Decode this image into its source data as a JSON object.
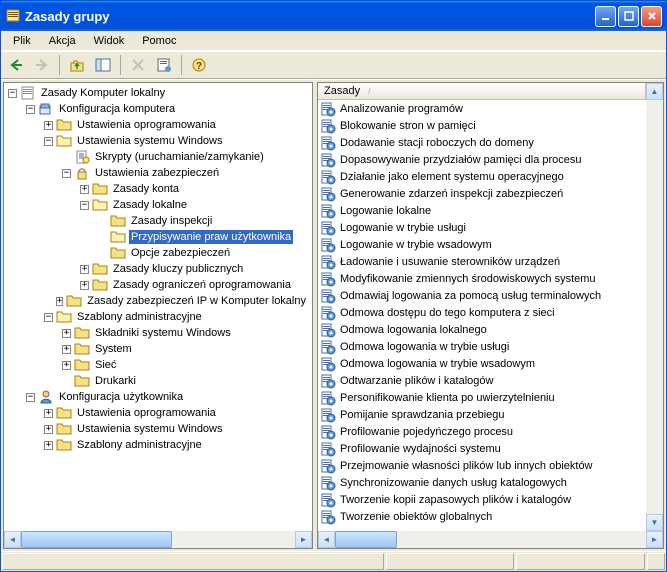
{
  "window": {
    "title": "Zasady grupy"
  },
  "menu": {
    "file": "Plik",
    "action": "Akcja",
    "view": "Widok",
    "help": "Pomoc"
  },
  "tree": {
    "root": "Zasady Komputer lokalny",
    "computer_config": "Konfiguracja komputera",
    "software_settings": "Ustawienia oprogramowania",
    "windows_settings": "Ustawienia systemu Windows",
    "scripts": "Skrypty (uruchamianie/zamykanie)",
    "security_settings": "Ustawienia zabezpieczeń",
    "account_policies": "Zasady konta",
    "local_policies": "Zasady lokalne",
    "audit_policy": "Zasady inspekcji",
    "user_rights": "Przypisywanie praw użytkownika",
    "security_options": "Opcje zabezpieczeń",
    "public_key": "Zasady kluczy publicznych",
    "software_restrict": "Zasady ograniczeń oprogramowania",
    "ipsec": "Zasady zabezpieczeń IP w Komputer lokalny",
    "admin_templates": "Szablony administracyjne",
    "windows_components": "Składniki systemu Windows",
    "system": "System",
    "network": "Sieć",
    "printers": "Drukarki",
    "user_config": "Konfiguracja użytkownika",
    "u_software_settings": "Ustawienia oprogramowania",
    "u_windows_settings": "Ustawienia systemu Windows",
    "u_admin_templates": "Szablony administracyjne"
  },
  "list": {
    "header": "Zasady",
    "items": [
      "Analizowanie programów",
      "Blokowanie stron w pamięci",
      "Dodawanie stacji roboczych do domeny",
      "Dopasowywanie przydziałów pamięci dla procesu",
      "Działanie jako element systemu operacyjnego",
      "Generowanie zdarzeń inspekcji zabezpieczeń",
      "Logowanie lokalne",
      "Logowanie w trybie usługi",
      "Logowanie w trybie wsadowym",
      "Ładowanie i usuwanie sterowników urządzeń",
      "Modyfikowanie zmiennych środowiskowych systemu",
      "Odmawiaj logowania za pomocą usług terminalowych",
      "Odmowa dostępu do tego komputera z sieci",
      "Odmowa logowania lokalnego",
      "Odmowa logowania w trybie usługi",
      "Odmowa logowania w trybie wsadowym",
      "Odtwarzanie plików i katalogów",
      "Personifikowanie klienta po uwierzytelnieniu",
      "Pomijanie sprawdzania przebiegu",
      "Profilowanie pojedyńczego procesu",
      "Profilowanie wydajności systemu",
      "Przejmowanie własności plików lub innych obiektów",
      "Synchronizowanie danych usług katalogowych",
      "Tworzenie kopii zapasowych plików i katalogów",
      "Tworzenie obiektów globalnych"
    ]
  }
}
